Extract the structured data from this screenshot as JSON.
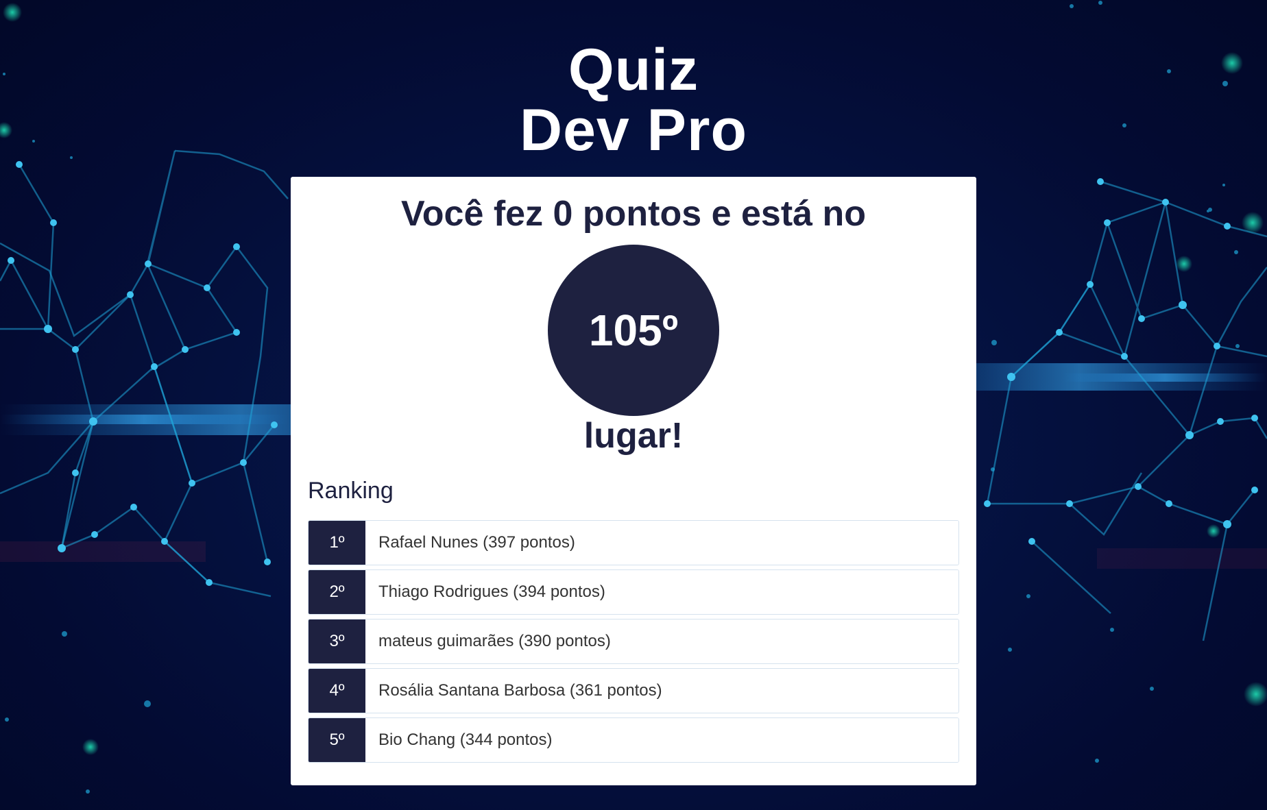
{
  "colors": {
    "background_dark": "#020828",
    "network_accent": "#1fa6d8",
    "dot_accent": "#1fe0b5",
    "card_background": "#ffffff",
    "brand_navy": "#1e2140"
  },
  "header": {
    "title_line1": "Quiz",
    "title_line2": "Dev Pro"
  },
  "result": {
    "headline": "Você fez 0 pontos e está no",
    "position": "105º",
    "tail": "lugar!"
  },
  "ranking": {
    "title": "Ranking",
    "entries": [
      {
        "position": "1º",
        "label": "Rafael Nunes (397 pontos)"
      },
      {
        "position": "2º",
        "label": "Thiago Rodrigues (394 pontos)"
      },
      {
        "position": "3º",
        "label": "mateus guimarães (390 pontos)"
      },
      {
        "position": "4º",
        "label": "Rosália Santana Barbosa (361 pontos)"
      },
      {
        "position": "5º",
        "label": "Bio Chang (344 pontos)"
      }
    ]
  }
}
